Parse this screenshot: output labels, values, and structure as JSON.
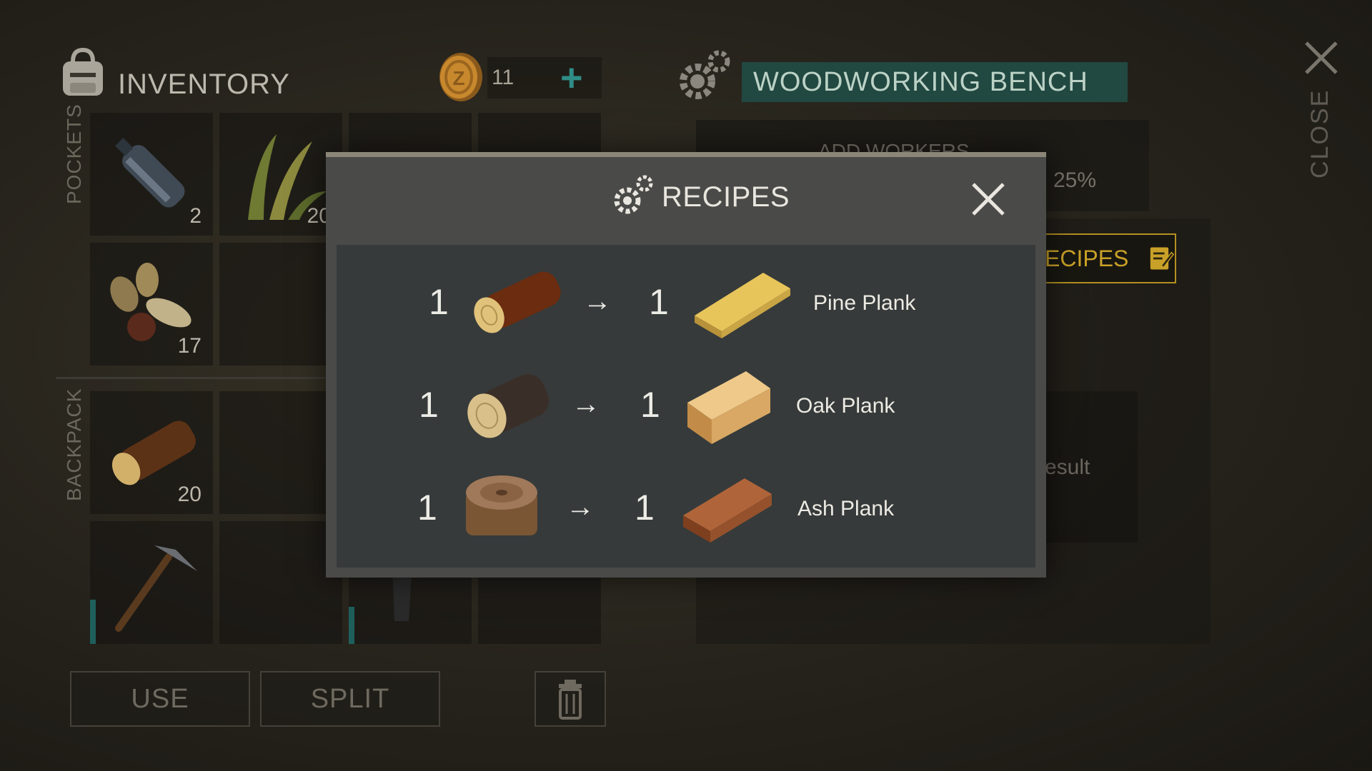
{
  "inventory": {
    "title": "INVENTORY",
    "coins": "11",
    "pockets_label": "POCKETS",
    "backpack_label": "BACKPACK",
    "slots": [
      {
        "item": "water-bottle",
        "count": "2"
      },
      {
        "item": "grass",
        "count": "20"
      },
      {
        "item": "seeds",
        "count": "17"
      },
      {
        "item": "log",
        "count": "20"
      },
      {
        "item": "pickaxe",
        "count": ""
      }
    ],
    "use_label": "USE",
    "split_label": "SPLIT"
  },
  "bench": {
    "title": "WOODWORKING BENCH",
    "add_workers": "ADD WORKERS",
    "bonus": "25%",
    "recipes_label": "ECIPES",
    "result_label": "esult"
  },
  "close_label": "CLOSE",
  "modal": {
    "title": "RECIPES",
    "recipes": [
      {
        "in_qty": "1",
        "out_qty": "1",
        "output": "Pine Plank",
        "arrow": "→"
      },
      {
        "in_qty": "1",
        "out_qty": "1",
        "output": "Oak Plank",
        "arrow": "→"
      },
      {
        "in_qty": "1",
        "out_qty": "1",
        "output": "Ash Plank",
        "arrow": "→"
      }
    ]
  },
  "colors": {
    "accent_teal": "#214841",
    "plus_teal": "#2f8d86",
    "recipes_gold": "#b49021",
    "modal_bg": "#4a4a48",
    "modal_inner": "#363a3a"
  }
}
